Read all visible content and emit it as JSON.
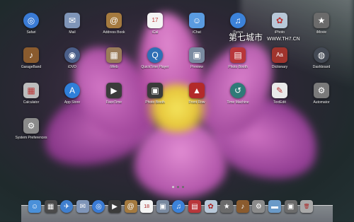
{
  "apps": [
    {
      "label": "Safari",
      "icon": "safari-icon",
      "glyph": "◎",
      "bg": "#3a7bd5"
    },
    {
      "label": "Mail",
      "icon": "mail-icon",
      "glyph": "✉",
      "bg": "#7f95b8"
    },
    {
      "label": "Address Book",
      "icon": "address-book-icon",
      "glyph": "@",
      "bg": "#a57a3f"
    },
    {
      "label": "iCal",
      "icon": "ical-icon",
      "glyph": "17",
      "bg": "#f4f4f4"
    },
    {
      "label": "iChat",
      "icon": "ichat-icon",
      "glyph": "☺",
      "bg": "#5a9be0"
    },
    {
      "label": "iTunes",
      "icon": "itunes-icon",
      "glyph": "♫",
      "bg": "#3c82d9"
    },
    {
      "label": "iPhoto",
      "icon": "iphoto-icon",
      "glyph": "✿",
      "bg": "#b8c8d8"
    },
    {
      "label": "iMovie",
      "icon": "imovie-icon",
      "glyph": "★",
      "bg": "#6b6b6b"
    },
    {
      "label": "GarageBand",
      "icon": "garageband-icon",
      "glyph": "♪",
      "bg": "#8a5b2e"
    },
    {
      "label": "iDVD",
      "icon": "idvd-icon",
      "glyph": "◉",
      "bg": "#4b5f8a"
    },
    {
      "label": "iWeb",
      "icon": "iweb-icon",
      "glyph": "▦",
      "bg": "#9a7c5a"
    },
    {
      "label": "QuickTime Player",
      "icon": "quicktime-icon",
      "glyph": "Q",
      "bg": "#2f6fb5"
    },
    {
      "label": "Preview",
      "icon": "preview-icon",
      "glyph": "▣",
      "bg": "#7a8aa0"
    },
    {
      "label": "Photo Booth",
      "icon": "photo-booth-icon",
      "glyph": "▤",
      "bg": "#b8363a"
    },
    {
      "label": "Dictionary",
      "icon": "dictionary-icon",
      "glyph": "Aa",
      "bg": "#a0342d"
    },
    {
      "label": "Dashboard",
      "icon": "dashboard-icon",
      "glyph": "◍",
      "bg": "#444a55"
    },
    {
      "label": "Calculator",
      "icon": "calculator-icon",
      "glyph": "▦",
      "bg": "#bdbdbd"
    },
    {
      "label": "App Store",
      "icon": "app-store-icon",
      "glyph": "A",
      "bg": "#2f7fd9"
    },
    {
      "label": "FaceTime",
      "icon": "facetime-icon",
      "glyph": "▶",
      "bg": "#3b3b3b"
    },
    {
      "label": "Photo Booth",
      "icon": "photo-booth-2-icon",
      "glyph": "▣",
      "bg": "#3a3a3a"
    },
    {
      "label": "Front Row",
      "icon": "front-row-icon",
      "glyph": "▲",
      "bg": "#b32a2a"
    },
    {
      "label": "Time Machine",
      "icon": "time-machine-icon",
      "glyph": "↺",
      "bg": "#2f7a78"
    },
    {
      "label": "TextEdit",
      "icon": "textedit-icon",
      "glyph": "✎",
      "bg": "#e9e9e9"
    },
    {
      "label": "Automator",
      "icon": "automator-icon",
      "glyph": "⚙",
      "bg": "#7a7a7a"
    },
    {
      "label": "System Preferences",
      "icon": "system-preferences-icon",
      "glyph": "⚙",
      "bg": "#8b8b8b"
    }
  ],
  "watermark": {
    "text": "第七城市",
    "url": "WWW.TH7.CN"
  },
  "page_indicator": {
    "current": 1,
    "total": 3
  },
  "dock": [
    {
      "name": "finder-icon",
      "glyph": "☺",
      "bg": "#4a90d9",
      "round": false
    },
    {
      "name": "mission-control-icon",
      "glyph": "▦",
      "bg": "#4a4a4a",
      "round": false
    },
    {
      "name": "launchpad-icon",
      "glyph": "✈",
      "bg": "#3f7fcf",
      "round": true
    },
    {
      "name": "mail-dock-icon",
      "glyph": "✉",
      "bg": "#7f95b8",
      "round": false
    },
    {
      "name": "safari-dock-icon",
      "glyph": "◎",
      "bg": "#3a7bd5",
      "round": true
    },
    {
      "name": "facetime-dock-icon",
      "glyph": "▶",
      "bg": "#3b3b3b",
      "round": false
    },
    {
      "name": "address-book-dock-icon",
      "glyph": "@",
      "bg": "#a57a3f",
      "round": false
    },
    {
      "name": "ical-dock-icon",
      "glyph": "18",
      "bg": "#f4f4f4",
      "round": false
    },
    {
      "name": "preview-dock-icon",
      "glyph": "▣",
      "bg": "#7a8aa0",
      "round": false
    },
    {
      "name": "itunes-dock-icon",
      "glyph": "♫",
      "bg": "#3c82d9",
      "round": true
    },
    {
      "name": "photo-booth-dock-icon",
      "glyph": "▤",
      "bg": "#b8363a",
      "round": false
    },
    {
      "name": "iphoto-dock-icon",
      "glyph": "✿",
      "bg": "#b8c8d8",
      "round": false
    },
    {
      "name": "imovie-dock-icon",
      "glyph": "★",
      "bg": "#6b6b6b",
      "round": false
    },
    {
      "name": "garageband-dock-icon",
      "glyph": "♪",
      "bg": "#8a5b2e",
      "round": false
    },
    {
      "name": "system-preferences-dock-icon",
      "glyph": "⚙",
      "bg": "#8b8b8b",
      "round": false
    },
    {
      "name": "applications-folder-icon",
      "glyph": "▬",
      "bg": "#6a9ac8",
      "round": false
    },
    {
      "name": "documents-stack-icon",
      "glyph": "▣",
      "bg": "#6b6b6b",
      "round": false
    },
    {
      "name": "trash-icon",
      "glyph": "🗑",
      "bg": "#a9a9a9",
      "round": false
    }
  ]
}
